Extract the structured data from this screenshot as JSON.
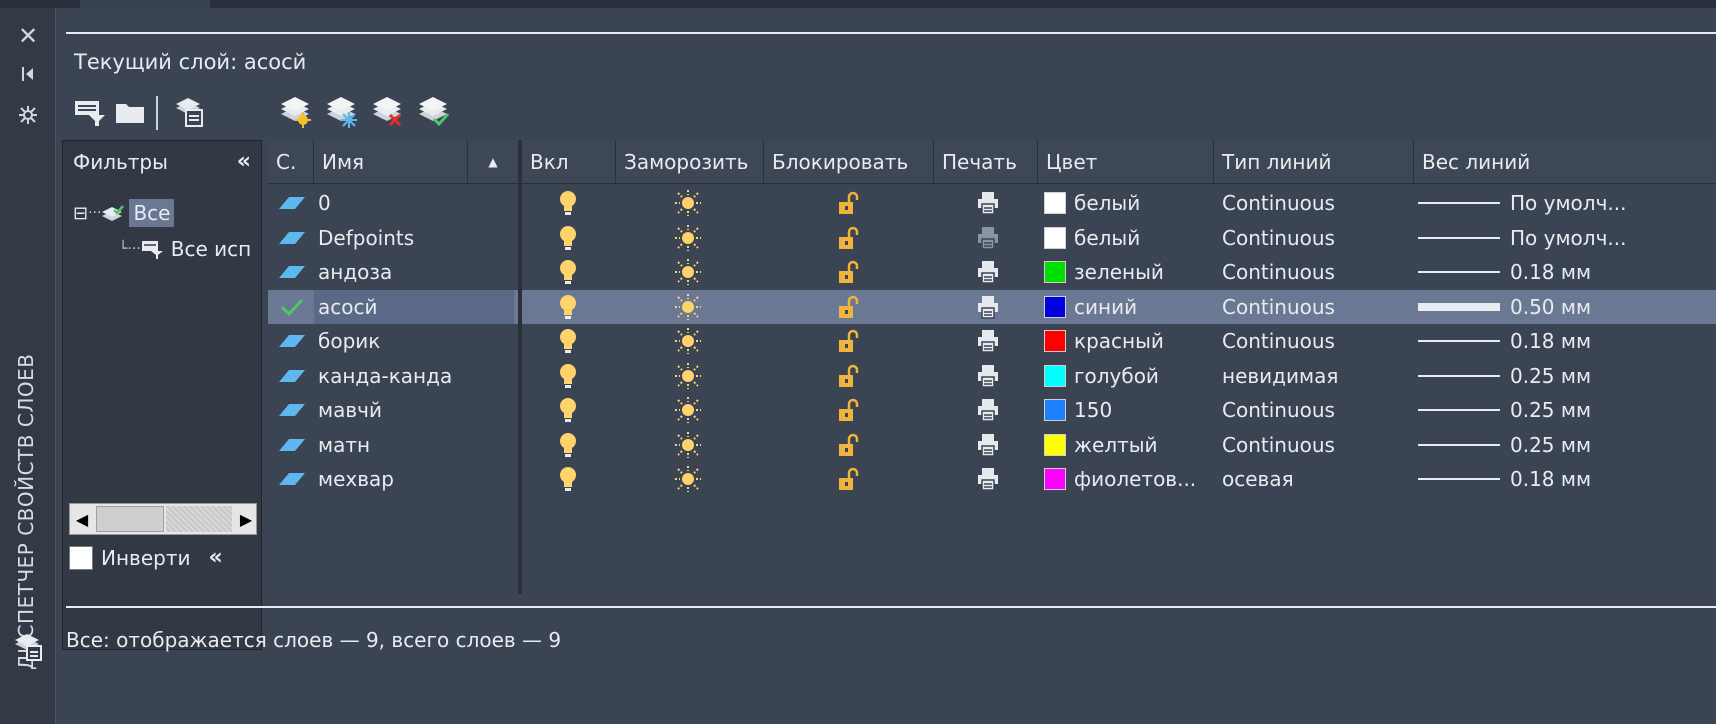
{
  "palette": {
    "title": "ДИСПЕТЧЕР СВОЙСТВ СЛОЕВ",
    "icons": [
      "close-icon",
      "auto-hide-icon",
      "properties-icon",
      "layer-states-icon"
    ]
  },
  "header": {
    "current_layer": "Текущий слой: асосй"
  },
  "toolbar": {
    "left_icons": [
      "new-property-filter-icon",
      "new-group-filter-icon",
      "layer-states-manager-icon"
    ],
    "right_icons": [
      "new-layer-icon",
      "new-layer-vp-frozen-icon",
      "delete-layer-icon",
      "set-current-icon"
    ]
  },
  "filters": {
    "header": "Фильтры",
    "collapse": "«",
    "tree": [
      {
        "label": "Все",
        "icon": "layers-icon",
        "selected": true
      },
      {
        "label": "Все исп",
        "icon": "filter-icon",
        "selected": false
      }
    ],
    "invert_label": "Инверти",
    "invert_checked": false
  },
  "columns": {
    "status": "С.",
    "name": "Имя",
    "on": "Вкл",
    "freeze": "Заморозить",
    "lock": "Блокировать",
    "plot": "Печать",
    "color": "Цвет",
    "linetype": "Тип линий",
    "lineweight": "Вес линий"
  },
  "layers": [
    {
      "name": "0",
      "current": false,
      "plot_enabled": true,
      "color_name": "белый",
      "color_hex": "#ffffff",
      "linetype": "Continuous",
      "lineweight": "По умолч..."
    },
    {
      "name": "Defpoints",
      "current": false,
      "plot_enabled": false,
      "color_name": "белый",
      "color_hex": "#ffffff",
      "linetype": "Continuous",
      "lineweight": "По умолч..."
    },
    {
      "name": "андоза",
      "current": false,
      "plot_enabled": true,
      "color_name": "зеленый",
      "color_hex": "#00e000",
      "linetype": "Continuous",
      "lineweight": "0.18 мм"
    },
    {
      "name": "асосй",
      "current": true,
      "plot_enabled": true,
      "color_name": "синий",
      "color_hex": "#0000e0",
      "linetype": "Continuous",
      "lineweight": "0.50 мм"
    },
    {
      "name": "борик",
      "current": false,
      "plot_enabled": true,
      "color_name": "красный",
      "color_hex": "#ff0000",
      "linetype": "Continuous",
      "lineweight": "0.18 мм"
    },
    {
      "name": "канда-канда",
      "current": false,
      "plot_enabled": true,
      "color_name": "голубой",
      "color_hex": "#00ffff",
      "linetype": "невидимая",
      "lineweight": "0.25 мм"
    },
    {
      "name": "мавчй",
      "current": false,
      "plot_enabled": true,
      "color_name": "150",
      "color_hex": "#1e7fff",
      "linetype": "Continuous",
      "lineweight": "0.25 мм"
    },
    {
      "name": "матн",
      "current": false,
      "plot_enabled": true,
      "color_name": "желтый",
      "color_hex": "#ffff00",
      "linetype": "Continuous",
      "lineweight": "0.25 мм"
    },
    {
      "name": "мехвар",
      "current": false,
      "plot_enabled": true,
      "color_name": "фиолетов...",
      "color_hex": "#ff00ff",
      "linetype": "осевая",
      "lineweight": "0.18 мм"
    }
  ],
  "status_bar": "Все: отображается слоев — 9, всего слоев — 9",
  "colors": {
    "background": "#3b4453",
    "selection": "#6a7893",
    "bulb": "#ffd36b",
    "lock": "#f0b43c"
  }
}
